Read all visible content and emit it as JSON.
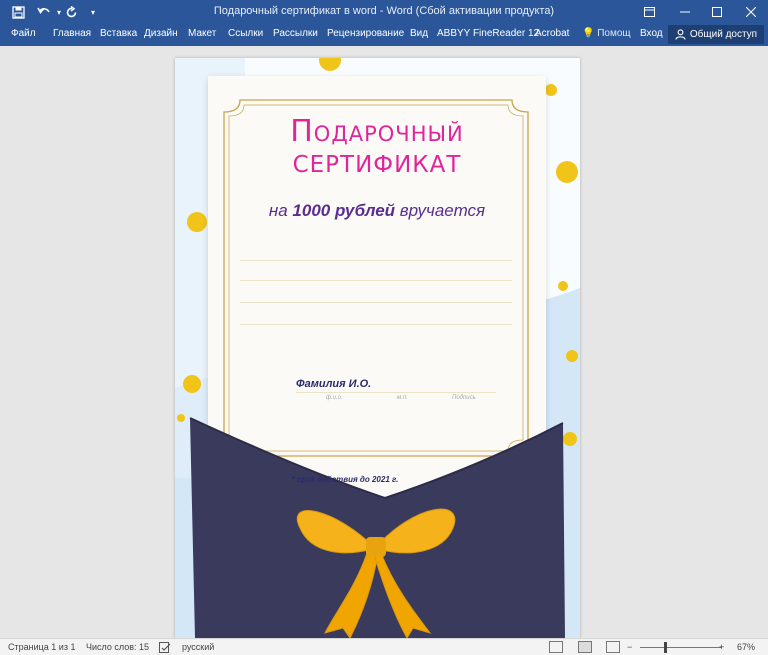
{
  "titlebar": {
    "title": "Подарочный сертификат в word - Word (Сбой активации продукта)",
    "minimize_icon": "minimize-icon",
    "restore_icon": "restore-icon",
    "close_icon": "close-icon"
  },
  "quick_access": {
    "save_icon": "save-icon",
    "undo_icon": "undo-icon",
    "redo_icon": "redo-icon",
    "customize_icon": "customize-icon"
  },
  "ribbon_tabs": [
    {
      "label": "Файл"
    },
    {
      "label": "Главная"
    },
    {
      "label": "Вставка"
    },
    {
      "label": "Дизайн"
    },
    {
      "label": "Макет"
    },
    {
      "label": "Ссылки"
    },
    {
      "label": "Рассылки"
    },
    {
      "label": "Рецензирование"
    },
    {
      "label": "Вид"
    },
    {
      "label": "ABBYY FineReader 12"
    },
    {
      "label": "Acrobat"
    }
  ],
  "ribbon_right": {
    "tell_me": "Помощ",
    "sign_in": "Вход",
    "share": "Общий доступ"
  },
  "certificate": {
    "title_line1": "Подарочный",
    "title_line2": "СЕРТИФИКАТ",
    "subtitle_prefix": "на ",
    "subtitle_amount": "1000 рублей",
    "subtitle_suffix": " вручается",
    "name": "Фамилия И.О.",
    "label_fio": "ф.и.о.",
    "label_mp": "м.п.",
    "label_signature": "Подпись",
    "validity": "* срок действия до 2021 г."
  },
  "colors": {
    "ribbon": "#2b579a",
    "title_pink": "#e0259a",
    "subtitle_purple": "#5b2d8e",
    "envelope": "#3a3a5c",
    "bow": "#f5b21b",
    "coin": "#f0c419",
    "page_bg": "#d4e7f7"
  },
  "statusbar": {
    "page": "Страница 1 из 1",
    "words": "Число слов: 15",
    "language": "русский",
    "zoom_out": "−",
    "zoom_in": "+",
    "zoom_percent": "67%"
  }
}
